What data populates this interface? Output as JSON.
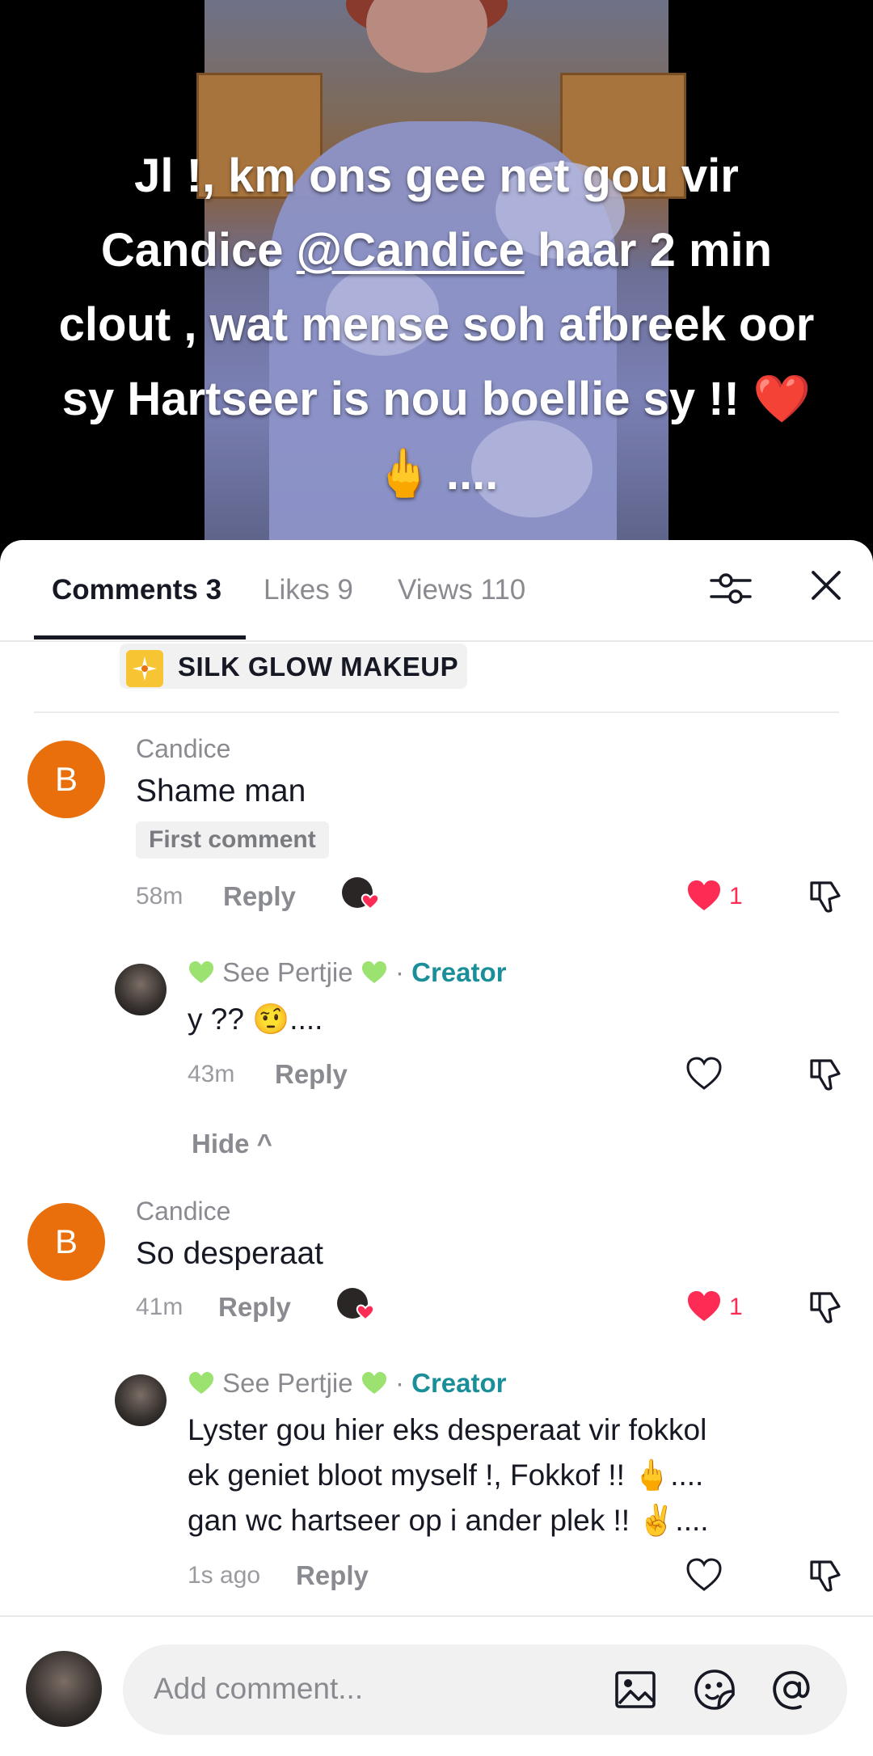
{
  "video": {
    "caption_part1": "Jl !, km ons gee net gou vir Candice ",
    "caption_mention": "@Candice",
    "caption_part2": " haar 2 min clout , wat mense soh afbreek oor sy Hartseer is nou boellie sy !! ❤️ 🖕 ...."
  },
  "tabs": {
    "comments": "Comments 3",
    "likes": "Likes 9",
    "views": "Views 110"
  },
  "ad": {
    "label": "SILK GLOW MAKEUP"
  },
  "comments": [
    {
      "avatar_letter": "B",
      "username": "Candice",
      "text": "Shame man",
      "badge": "First comment",
      "time": "58m",
      "reply_label": "Reply",
      "likes": "1",
      "reply": {
        "username": "See Pertjie",
        "role": "Creator",
        "text": "y ?? 🤨....",
        "time": "43m",
        "reply_label": "Reply"
      }
    },
    {
      "avatar_letter": "B",
      "username": "Candice",
      "text": "So desperaat",
      "time": "41m",
      "reply_label": "Reply",
      "likes": "1",
      "reply": {
        "username": "See Pertjie",
        "role": "Creator",
        "text_line1": "Lyster gou hier eks desperaat vir fokkol",
        "text_line2": "ek geniet bloot myself !, Fokkof !! 🖕....",
        "text_line3": "gan wc hartseer op i ander plek !! ✌️....",
        "time": "1s ago",
        "reply_label": "Reply"
      }
    }
  ],
  "hide_label": "Hide ^",
  "separator": "·",
  "comment_input": {
    "placeholder": "Add comment..."
  },
  "colors": {
    "like": "#fe2c55",
    "creator": "#1a8f99",
    "avatar_b": "#e86f0c"
  },
  "icons": [
    "filter-icon",
    "close-icon",
    "heart-icon",
    "dislike-icon",
    "image-icon",
    "sticker-icon",
    "mention-icon"
  ]
}
